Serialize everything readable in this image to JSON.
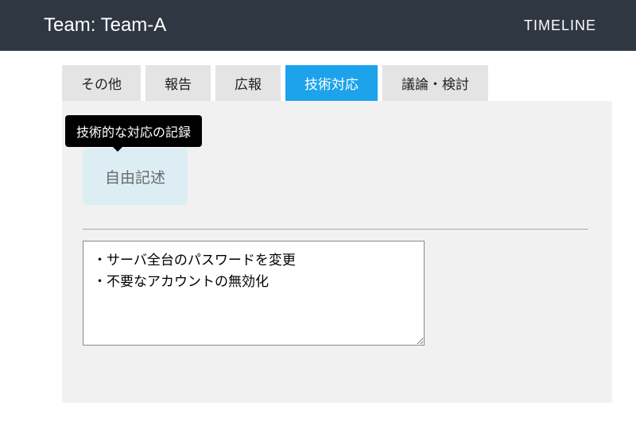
{
  "header": {
    "title": "Team: Team-A",
    "timeline_link": "TIMELINE"
  },
  "tabs": [
    {
      "label": "その他",
      "active": false
    },
    {
      "label": "報告",
      "active": false
    },
    {
      "label": "広報",
      "active": false
    },
    {
      "label": "技術対応",
      "active": true
    },
    {
      "label": "議論・検討",
      "active": false
    }
  ],
  "tooltip": {
    "text": "技術的な対応の記録"
  },
  "subtab": {
    "label": "自由記述"
  },
  "textarea": {
    "value": "・サーバ全台のパスワードを変更\n・不要なアカウントの無効化"
  }
}
